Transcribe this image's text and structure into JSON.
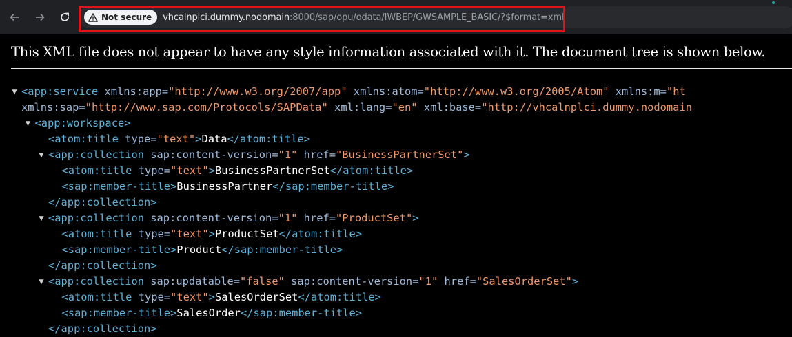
{
  "browser": {
    "security_chip": "Not secure",
    "url_host": "vhcalnplci.dummy.nodomain",
    "url_rest": ":8000/sap/opu/odata/IWBEP/GWSAMPLE_BASIC/?$format=xml",
    "icons": {
      "back": "arrow-left-icon",
      "forward": "arrow-right-icon",
      "reload": "reload-icon",
      "warning": "warning-triangle-icon"
    }
  },
  "notice": "This XML file does not appear to have any style information associated with it. The document tree is shown below.",
  "xml": {
    "lines": [
      {
        "tokens": [
          "<app:service",
          " xmlns:app=",
          "\"http://www.w3.org/2007/app\"",
          " xmlns:atom=",
          "\"http://www.w3.org/2005/Atom\"",
          " xmlns:m=",
          "\"ht"
        ]
      },
      {
        "tokens": [
          "xmlns:sap=",
          "\"http://www.sap.com/Protocols/SAPData\"",
          " xml:lang=",
          "\"en\"",
          " xml:base=",
          "\"http://vhcalnplci.dummy.nodomain"
        ]
      },
      {
        "tokens": [
          "<app:workspace>"
        ]
      },
      {
        "tokens": [
          "<atom:title",
          " type=",
          "\"text\"",
          ">",
          "Data",
          "</atom:title>"
        ]
      },
      {
        "tokens": [
          "<app:collection",
          " sap:content-version=",
          "\"1\"",
          " href=",
          "\"BusinessPartnerSet\"",
          ">"
        ]
      },
      {
        "tokens": [
          "<atom:title",
          " type=",
          "\"text\"",
          ">",
          "BusinessPartnerSet",
          "</atom:title>"
        ]
      },
      {
        "tokens": [
          "<sap:member-title>",
          "BusinessPartner",
          "</sap:member-title>"
        ]
      },
      {
        "tokens": [
          "</app:collection>"
        ]
      },
      {
        "tokens": [
          "<app:collection",
          " sap:content-version=",
          "\"1\"",
          " href=",
          "\"ProductSet\"",
          ">"
        ]
      },
      {
        "tokens": [
          "<atom:title",
          " type=",
          "\"text\"",
          ">",
          "ProductSet",
          "</atom:title>"
        ]
      },
      {
        "tokens": [
          "<sap:member-title>",
          "Product",
          "</sap:member-title>"
        ]
      },
      {
        "tokens": [
          "</app:collection>"
        ]
      },
      {
        "tokens": [
          "<app:collection",
          " sap:updatable=",
          "\"false\"",
          " sap:content-version=",
          "\"1\"",
          " href=",
          "\"SalesOrderSet\"",
          ">"
        ]
      },
      {
        "tokens": [
          "<atom:title",
          " type=",
          "\"text\"",
          ">",
          "SalesOrderSet",
          "</atom:title>"
        ]
      },
      {
        "tokens": [
          "<sap:member-title>",
          "SalesOrder",
          "</sap:member-title>"
        ]
      },
      {
        "tokens": [
          "</app:collection>"
        ]
      }
    ],
    "collapse_glyph": "▼"
  }
}
